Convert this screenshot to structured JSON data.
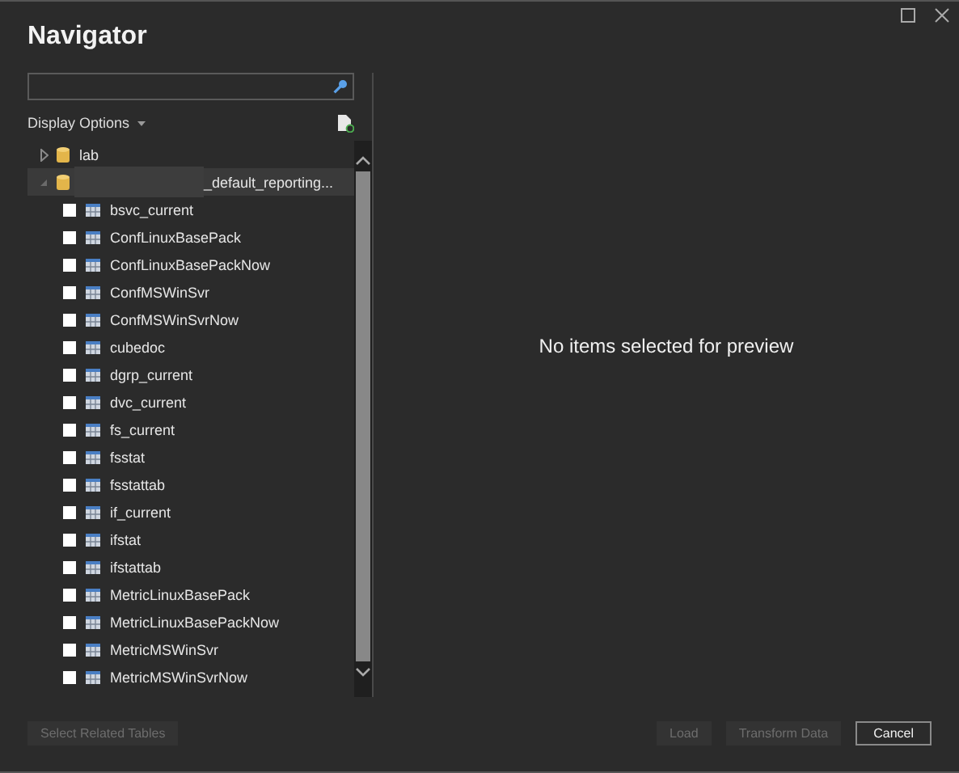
{
  "window": {
    "title": "Navigator"
  },
  "display_options": {
    "label": "Display Options"
  },
  "tree": [
    {
      "label": "lab",
      "expanded": false,
      "selected": false,
      "redacted": false
    },
    {
      "label": "_default_reporting...",
      "expanded": true,
      "selected": true,
      "redacted": true,
      "children": [
        {
          "label": "bsvc_current",
          "checked": false
        },
        {
          "label": "ConfLinuxBasePack",
          "checked": false
        },
        {
          "label": "ConfLinuxBasePackNow",
          "checked": false
        },
        {
          "label": "ConfMSWinSvr",
          "checked": false
        },
        {
          "label": "ConfMSWinSvrNow",
          "checked": false
        },
        {
          "label": "cubedoc",
          "checked": false
        },
        {
          "label": "dgrp_current",
          "checked": false
        },
        {
          "label": "dvc_current",
          "checked": false
        },
        {
          "label": "fs_current",
          "checked": false
        },
        {
          "label": "fsstat",
          "checked": false
        },
        {
          "label": "fsstattab",
          "checked": false
        },
        {
          "label": "if_current",
          "checked": false
        },
        {
          "label": "ifstat",
          "checked": false
        },
        {
          "label": "ifstattab",
          "checked": false
        },
        {
          "label": "MetricLinuxBasePack",
          "checked": false
        },
        {
          "label": "MetricLinuxBasePackNow",
          "checked": false
        },
        {
          "label": "MetricMSWinSvr",
          "checked": false
        },
        {
          "label": "MetricMSWinSvrNow",
          "checked": false
        }
      ]
    }
  ],
  "preview": {
    "message": "No items selected for preview"
  },
  "buttons": [
    {
      "label": "Select Related Tables",
      "kind": "secondary",
      "disabled": true
    },
    {
      "label": "Load",
      "kind": "primary",
      "disabled": true
    },
    {
      "label": "Transform Data",
      "kind": "primary",
      "disabled": true
    },
    {
      "label": "Cancel",
      "kind": "primary",
      "disabled": false
    }
  ]
}
